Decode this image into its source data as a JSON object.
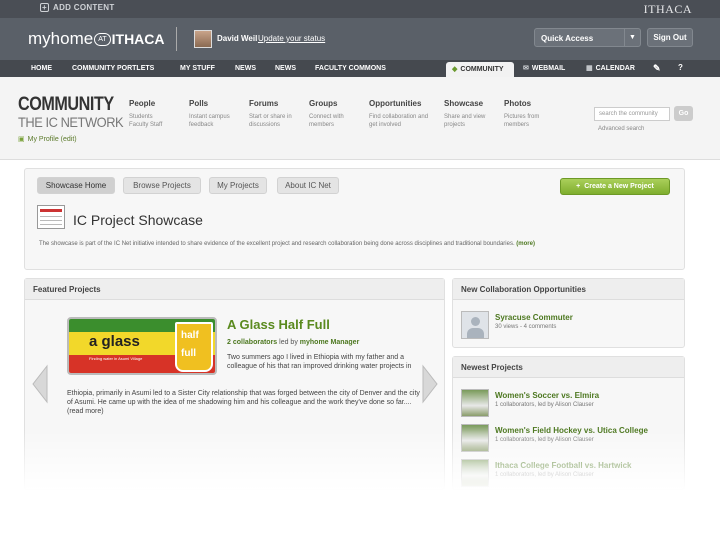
{
  "admin_bar": {
    "add_content": "ADD CONTENT",
    "wordmark": "ITHACA"
  },
  "header": {
    "logo_main": "myhome",
    "logo_at": "AT",
    "logo_ithaca": "ITHACA",
    "user_name": "David Weil",
    "update_link": "Update your status",
    "quick_access": "Quick Access",
    "signout": "Sign Out"
  },
  "nav": {
    "items": [
      "HOME",
      "COMMUNITY PORTLETS",
      "MY STUFF",
      "NEWS",
      "NEWS",
      "FACULTY COMMONS"
    ],
    "active_tab": "COMMUNITY",
    "webmail": "WEBMAIL",
    "calendar": "CALENDAR"
  },
  "community": {
    "brand_line1": "COMMUNITY",
    "brand_line2": "THE IC NETWORK",
    "my_profile": "My Profile (edit)",
    "categories": [
      {
        "title": "People",
        "desc": "Students\nFaculty Staff"
      },
      {
        "title": "Polls",
        "desc": "Instant campus\nfeedback"
      },
      {
        "title": "Forums",
        "desc": "Start or share in\ndiscussions"
      },
      {
        "title": "Groups",
        "desc": "Connect with\nmembers"
      },
      {
        "title": "Opportunities",
        "desc": "Find collaboration and\nget involved"
      },
      {
        "title": "Showcase",
        "desc": "Share and view\nprojects"
      },
      {
        "title": "Photos",
        "desc": "Pictures from\nmembers"
      }
    ],
    "search_placeholder": "search the community",
    "go": "Go",
    "advanced_search": "Advanced search"
  },
  "showcase": {
    "tabs": [
      "Showcase Home",
      "Browse Projects",
      "My Projects",
      "About IC Net"
    ],
    "create_button": "Create a New Project",
    "title": "IC Project Showcase",
    "description": "The showcase is part of the IC Net initiative intended to share evidence of the excellent project and research collaboration being done across disciplines and traditional boundaries.",
    "more": "(more)"
  },
  "featured": {
    "heading": "Featured Projects",
    "image_text": "a glass",
    "image_cup_top": "half",
    "image_cup_bottom": "full",
    "image_tagline": "Finding water in Asumi Village",
    "project_title": "A Glass Half Full",
    "collaborators": "2 collaborators",
    "led_by_prefix": "led by",
    "leader": "myhome Manager",
    "desc_right": "Two summers ago I lived in Ethiopia with my father and a colleague of his that ran improved drinking water projects in",
    "desc_full": "Ethiopia, primarily in Asumi led to a Sister City relationship that was forged between the city of Denver and the city of Asumi. He came up with the idea of me shadowing him and his colleague and the work they've done so far.... (read more)"
  },
  "collab": {
    "heading": "New Collaboration Opportunities",
    "item_name": "Syracuse Commuter",
    "item_meta": "30 views - 4 comments"
  },
  "newest": {
    "heading": "Newest Projects",
    "items": [
      {
        "name": "Women's Soccer vs. Elmira",
        "meta": "1 collaborators, led by Alison Clauser"
      },
      {
        "name": "Women's Field Hockey vs. Utica College",
        "meta": "1 collaborators, led by Alison Clauser"
      },
      {
        "name": "Ithaca College Football vs. Hartwick",
        "meta": "1 collaborators, led by Alison Clauser"
      }
    ]
  }
}
